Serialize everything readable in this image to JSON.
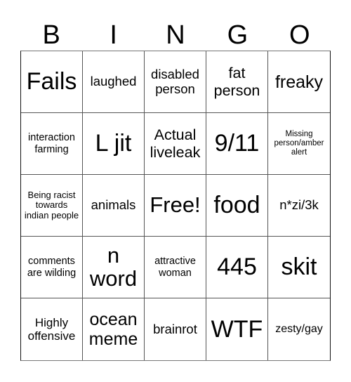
{
  "header": {
    "letters": [
      "B",
      "I",
      "N",
      "G",
      "O"
    ]
  },
  "board": {
    "rows": [
      [
        "Fails",
        "laughed",
        "disabled person",
        "fat person",
        "freaky"
      ],
      [
        "interaction farming",
        "L jit",
        "Actual liveleak",
        "9/11",
        "Missing person/amber alert"
      ],
      [
        "Being racist towards indian people",
        "animals",
        "Free!",
        "food",
        "n*zi/3k"
      ],
      [
        "comments are wilding",
        "n word",
        "attractive woman",
        "445",
        "skit"
      ],
      [
        "Highly offensive",
        "ocean meme",
        "brainrot",
        "WTF",
        "zesty/gay"
      ]
    ],
    "free_space": "Free!"
  },
  "colors": {
    "background": "#ffffff",
    "text": "#000000",
    "grid_line": "#555555"
  }
}
